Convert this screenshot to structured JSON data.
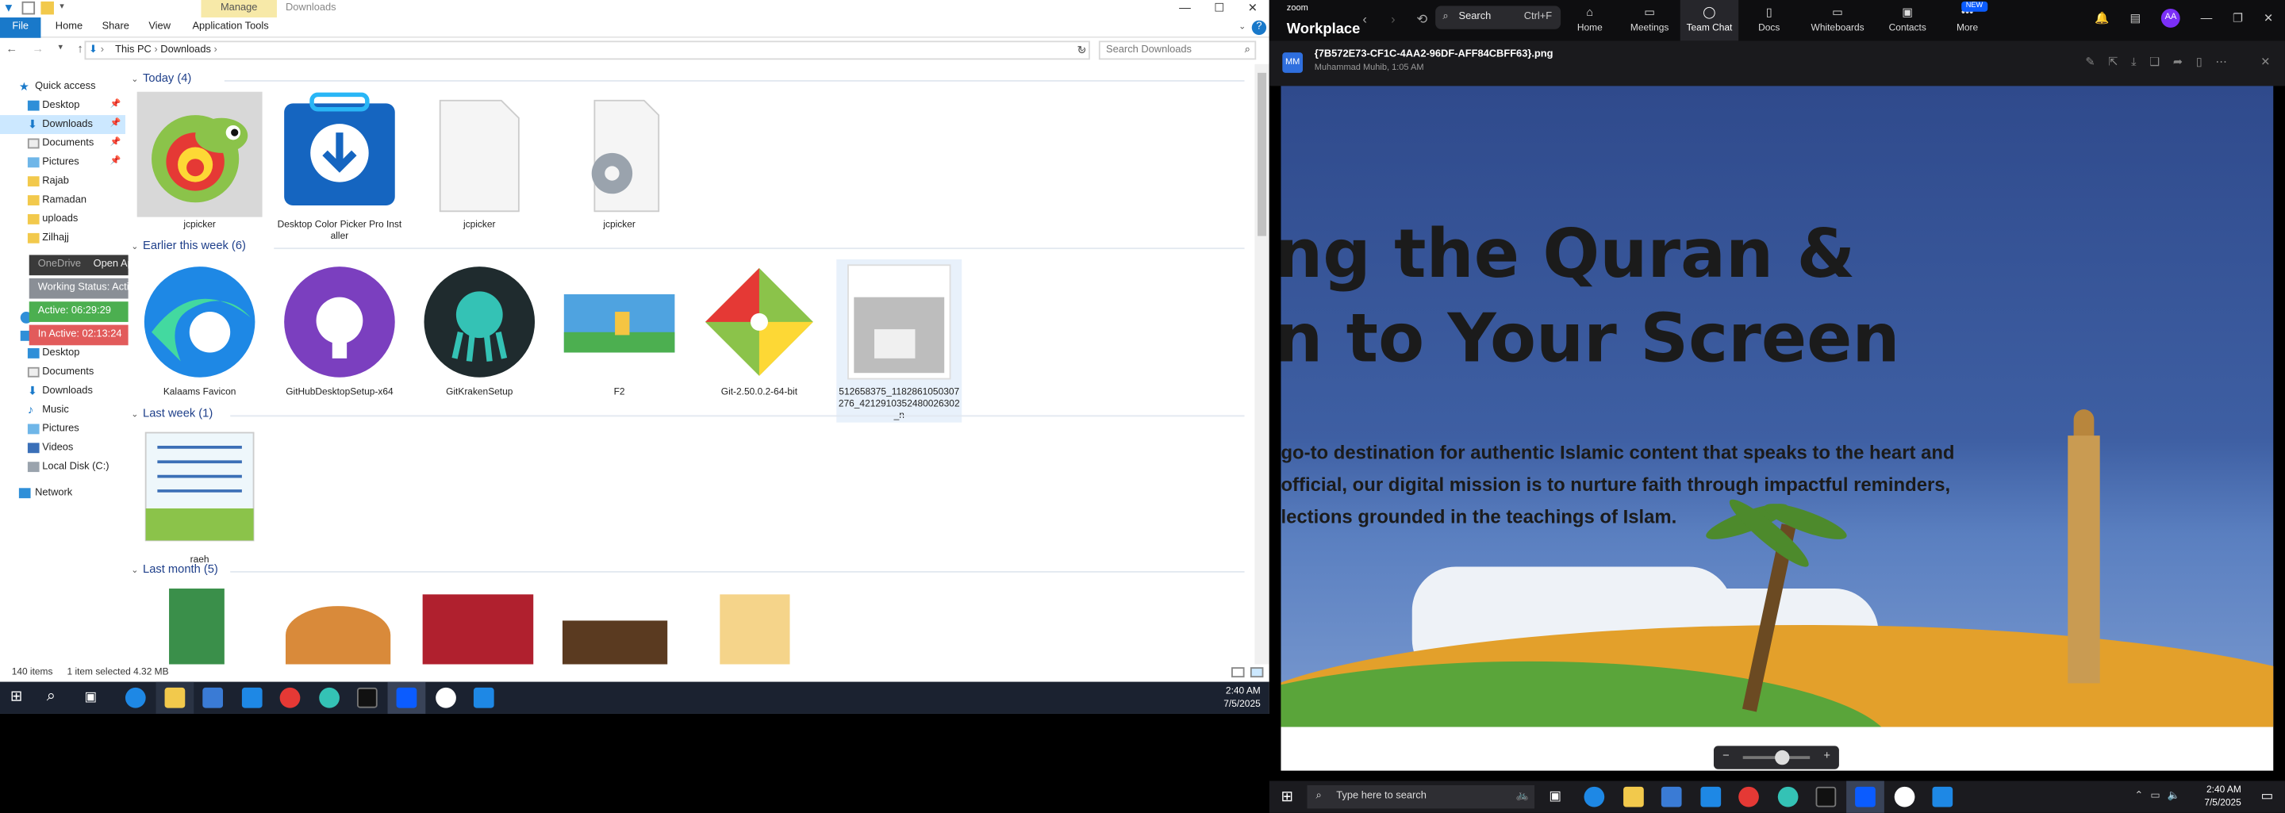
{
  "explorer": {
    "title": "Downloads",
    "manage_tab": "Manage",
    "window_controls": [
      "—",
      "☐",
      "✕"
    ],
    "menu": {
      "file": "File",
      "items": [
        "Home",
        "Share",
        "View",
        "Application Tools"
      ]
    },
    "address": {
      "path": [
        "This PC",
        "Downloads"
      ],
      "search_placeholder": "Search Downloads"
    },
    "nav_pane": {
      "items": [
        {
          "label": "Quick access",
          "type": "quick"
        },
        {
          "label": "Desktop",
          "type": "folder-blue",
          "pinned": true
        },
        {
          "label": "Downloads",
          "type": "download",
          "pinned": true,
          "selected": true
        },
        {
          "label": "Documents",
          "type": "doc",
          "pinned": true
        },
        {
          "label": "Pictures",
          "type": "folder-blue",
          "pinned": true
        },
        {
          "label": "Rajab",
          "type": "folder"
        },
        {
          "label": "Ramadan",
          "type": "folder"
        },
        {
          "label": "uploads",
          "type": "folder"
        },
        {
          "label": "Zilhajj",
          "type": "folder"
        },
        {
          "label": "Desktop",
          "type": "folder-blue"
        },
        {
          "label": "Documents",
          "type": "doc"
        },
        {
          "label": "Downloads",
          "type": "download"
        },
        {
          "label": "Music",
          "type": "music"
        },
        {
          "label": "Pictures",
          "type": "folder-blue"
        },
        {
          "label": "Videos",
          "type": "folder-blue"
        },
        {
          "label": "Local Disk (C:)",
          "type": "disk"
        },
        {
          "label": "Network",
          "type": "network"
        }
      ]
    },
    "tracker": {
      "onedrive": "OneDrive",
      "open_app": "Open App ↗",
      "working_status": "Working Status: Active",
      "active": "Active: 06:29:29",
      "inactive": "In Active: 02:13:24"
    },
    "groups": [
      {
        "label": "Today (4)",
        "files": [
          "jcpicker",
          "Desktop Color Picker Pro Installer",
          "jcpicker",
          "jcpicker"
        ]
      },
      {
        "label": "Earlier this week (6)",
        "files": [
          "Kalaams Favicon",
          "GitHubDesktopSetup-x64",
          "GitKrakenSetup",
          "F2",
          "Git-2.50.0.2-64-bit",
          "512658375_1182861050307276_4212910352480026302_n"
        ]
      },
      {
        "label": "Last week (1)",
        "files": [
          "raeh"
        ]
      },
      {
        "label": "Last month (5)",
        "files": []
      }
    ],
    "status": {
      "items_count": "140 items",
      "selected": "1 item selected  4.32 MB"
    },
    "clock": {
      "time": "2:40 AM",
      "date": "7/5/2025"
    }
  },
  "zoom": {
    "logo_small": "zoom",
    "logo_big": "Workplace",
    "search_label": "Search",
    "search_shortcut": "Ctrl+F",
    "tabs": [
      {
        "label": "Home",
        "icon": "⌂"
      },
      {
        "label": "Meetings",
        "icon": "▭"
      },
      {
        "label": "Team Chat",
        "icon": "◯",
        "active": true
      },
      {
        "label": "Docs",
        "icon": "▯"
      },
      {
        "label": "Whiteboards",
        "icon": "▭"
      },
      {
        "label": "Contacts",
        "icon": "▣"
      },
      {
        "label": "More",
        "icon": "•••"
      }
    ],
    "new_badge": "NEW",
    "avatar": "AA",
    "image": {
      "sender_initials": "MM",
      "title": "{7B572E73-CF1C-4AA2-96DF-AFF84CBFF63}.png",
      "subtitle": "Muhammad Muhib, 1:05 AM",
      "line1": "ng the Quran &",
      "line2": "n to Your Screen",
      "para1": " go-to destination for authentic Islamic content that speaks to the heart and",
      "para2": "official, our digital mission is to nurture faith through impactful reminders,",
      "para3": "lections grounded in the teachings of Islam."
    },
    "taskbar": {
      "search_placeholder": "Type here to search",
      "time": "2:40 AM",
      "date": "7/5/2025"
    }
  }
}
